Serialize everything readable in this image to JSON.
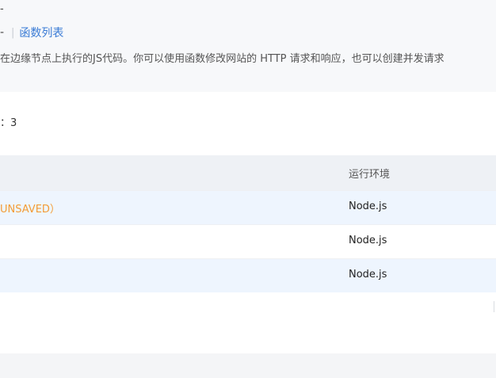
{
  "header": {
    "breadcrumb_fragment": "-",
    "breadcrumb_dash": "-",
    "breadcrumb_separator": "|",
    "breadcrumb_link": "函数列表",
    "description": "在边缘节点上执行的JS代码。你可以使用函数修改网站的 HTTP 请求和响应，也可以创建并发请求"
  },
  "summary": {
    "count_text": "：3"
  },
  "table": {
    "columns": {
      "runtime": "运行环境"
    },
    "rows": [
      {
        "name": "UNSAVED）",
        "runtime": "Node.js"
      },
      {
        "name": "",
        "runtime": "Node.js"
      },
      {
        "name": "",
        "runtime": "Node.js"
      }
    ]
  },
  "colors": {
    "link": "#3a7bd5",
    "unsaved": "#f39c36",
    "row_highlight": "#eef5fe",
    "header_bg": "#eef1f5"
  }
}
